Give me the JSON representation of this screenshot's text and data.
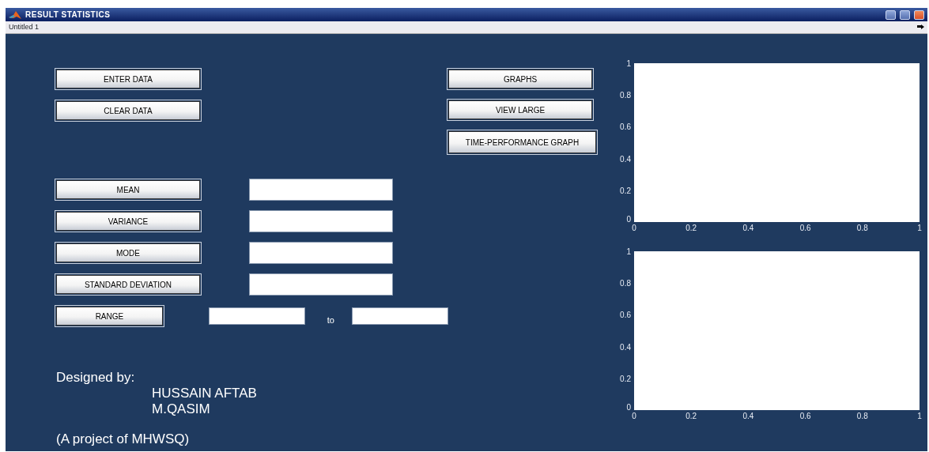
{
  "window": {
    "title": "RESULT STATISTICS"
  },
  "menu_bar": {
    "label": "Untitled 1"
  },
  "data_buttons": [
    "ENTER DATA",
    "CLEAR DATA"
  ],
  "graph_buttons": [
    "GRAPHS",
    "VIEW LARGE",
    "TIME-PERFORMANCE GRAPH"
  ],
  "statistics": [
    {
      "kind": "single",
      "label": "MEAN"
    },
    {
      "kind": "single",
      "label": "VARIANCE"
    },
    {
      "kind": "single",
      "label": "MODE"
    },
    {
      "kind": "single",
      "label": "STANDARD DEVIATION"
    },
    {
      "kind": "range",
      "label": "RANGE",
      "separator": "to"
    }
  ],
  "credits": {
    "heading": "Designed by:",
    "names": [
      "HUSSAIN AFTAB",
      "M.QASIM"
    ],
    "footer": "(A project of MHWSQ)"
  },
  "charts": [
    {
      "chart_data": {
        "type": "line",
        "xlim": [
          0,
          1
        ],
        "ylim": [
          0,
          1
        ],
        "xticks": [
          {
            "value": 0,
            "label": "0"
          },
          {
            "value": 0.2,
            "label": "0.2"
          },
          {
            "value": 0.4,
            "label": "0.4"
          },
          {
            "value": 0.6,
            "label": "0.6"
          },
          {
            "value": 0.8,
            "label": "0.8"
          },
          {
            "value": 1,
            "label": "1"
          }
        ],
        "yticks": [
          {
            "value": 0,
            "label": "0"
          },
          {
            "value": 0.2,
            "label": "0.2"
          },
          {
            "value": 0.4,
            "label": "0.4"
          },
          {
            "value": 0.6,
            "label": "0.6"
          },
          {
            "value": 0.8,
            "label": "0.8"
          },
          {
            "value": 1,
            "label": "1"
          }
        ]
      }
    },
    {
      "chart_data": {
        "type": "line",
        "xlim": [
          0,
          1
        ],
        "ylim": [
          0,
          1
        ],
        "xticks": [
          {
            "value": 0,
            "label": "0"
          },
          {
            "value": 0.2,
            "label": "0.2"
          },
          {
            "value": 0.4,
            "label": "0.4"
          },
          {
            "value": 0.6,
            "label": "0.6"
          },
          {
            "value": 0.8,
            "label": "0.8"
          },
          {
            "value": 1,
            "label": "1"
          }
        ],
        "yticks": [
          {
            "value": 0,
            "label": "0"
          },
          {
            "value": 0.2,
            "label": "0.2"
          },
          {
            "value": 0.4,
            "label": "0.4"
          },
          {
            "value": 0.6,
            "label": "0.6"
          },
          {
            "value": 0.8,
            "label": "0.8"
          },
          {
            "value": 1,
            "label": "1"
          }
        ]
      }
    }
  ]
}
